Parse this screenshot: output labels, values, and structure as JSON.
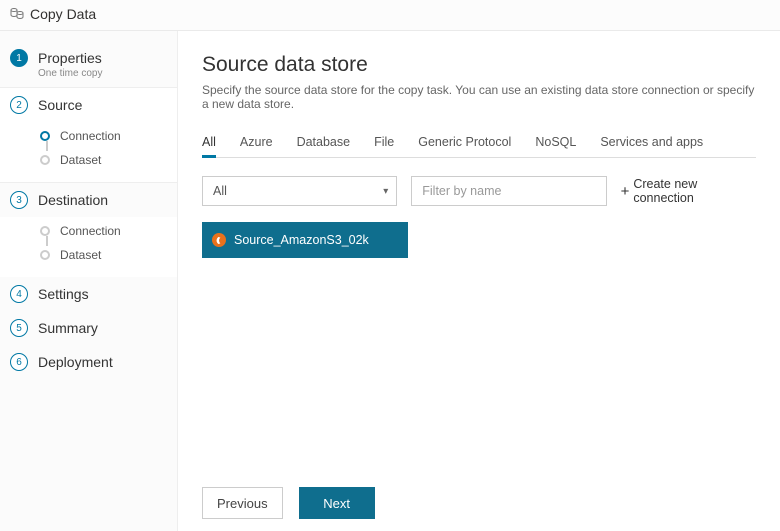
{
  "title": "Copy Data",
  "sidebar": {
    "steps": [
      {
        "num": "1",
        "label": "Properties",
        "sub": "One time copy"
      },
      {
        "num": "2",
        "label": "Source"
      },
      {
        "num": "3",
        "label": "Destination"
      },
      {
        "num": "4",
        "label": "Settings"
      },
      {
        "num": "5",
        "label": "Summary"
      },
      {
        "num": "6",
        "label": "Deployment"
      }
    ],
    "source_substeps": {
      "connection": "Connection",
      "dataset": "Dataset"
    },
    "dest_substeps": {
      "connection": "Connection",
      "dataset": "Dataset"
    }
  },
  "main": {
    "heading": "Source data store",
    "description": "Specify the source data store for the copy task. You can use an existing data store connection or specify a new data store.",
    "tabs": {
      "all": "All",
      "azure": "Azure",
      "database": "Database",
      "file": "File",
      "generic": "Generic Protocol",
      "nosql": "NoSQL",
      "services": "Services and apps"
    },
    "filter_select": "All",
    "filter_placeholder": "Filter by name",
    "create_new": "Create new connection",
    "cards": [
      {
        "label": "Source_AmazonS3_02k"
      }
    ],
    "footer": {
      "previous": "Previous",
      "next": "Next"
    }
  }
}
